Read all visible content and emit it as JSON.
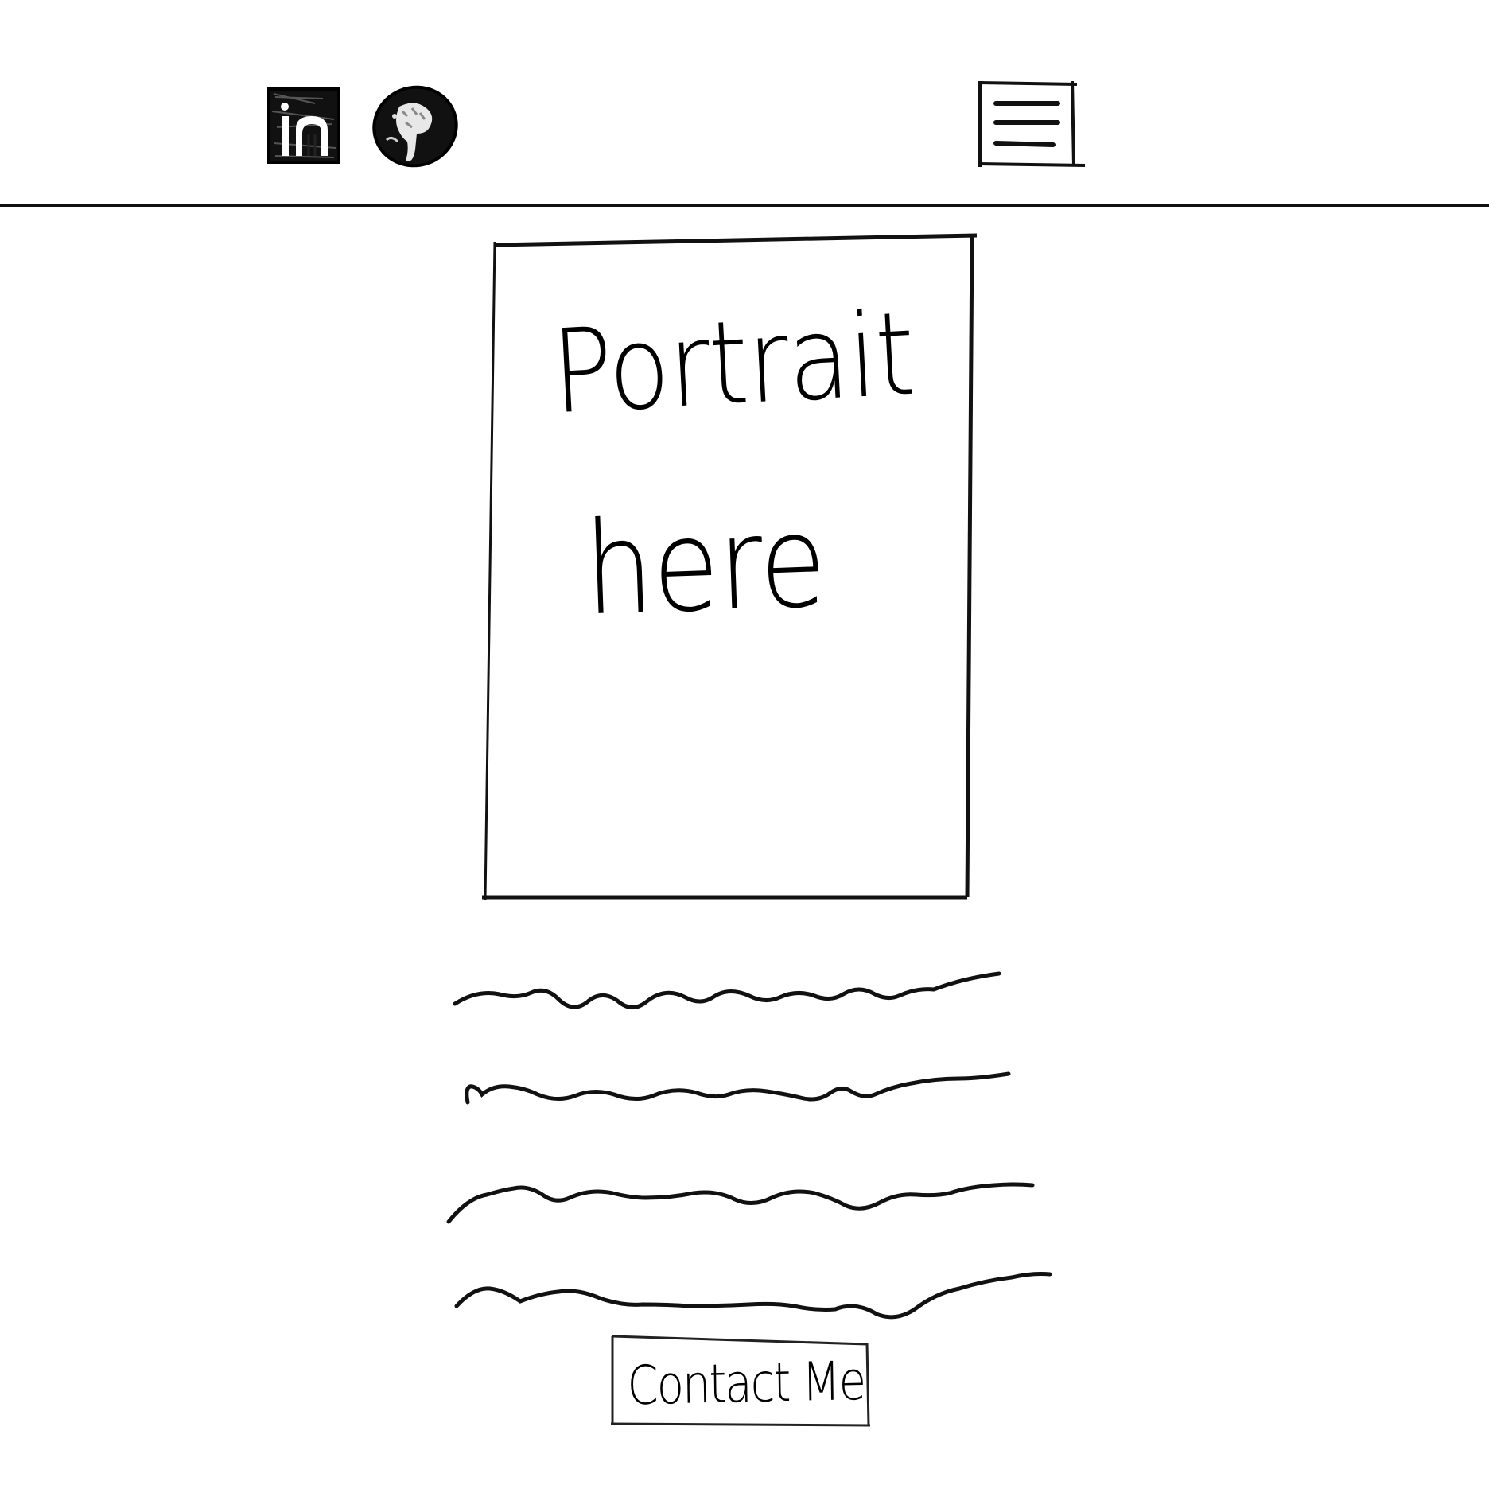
{
  "header": {
    "social_links": [
      {
        "icon": "linkedin-icon"
      },
      {
        "icon": "github-icon"
      }
    ],
    "menu": {
      "icon": "hamburger-menu-icon"
    }
  },
  "portrait": {
    "line1": "Portrait",
    "line2": "here"
  },
  "bio": {
    "placeholder_line_count": 4
  },
  "contact": {
    "label": "Contact Me"
  },
  "colors": {
    "ink": "#000000",
    "background": "#ffffff"
  }
}
